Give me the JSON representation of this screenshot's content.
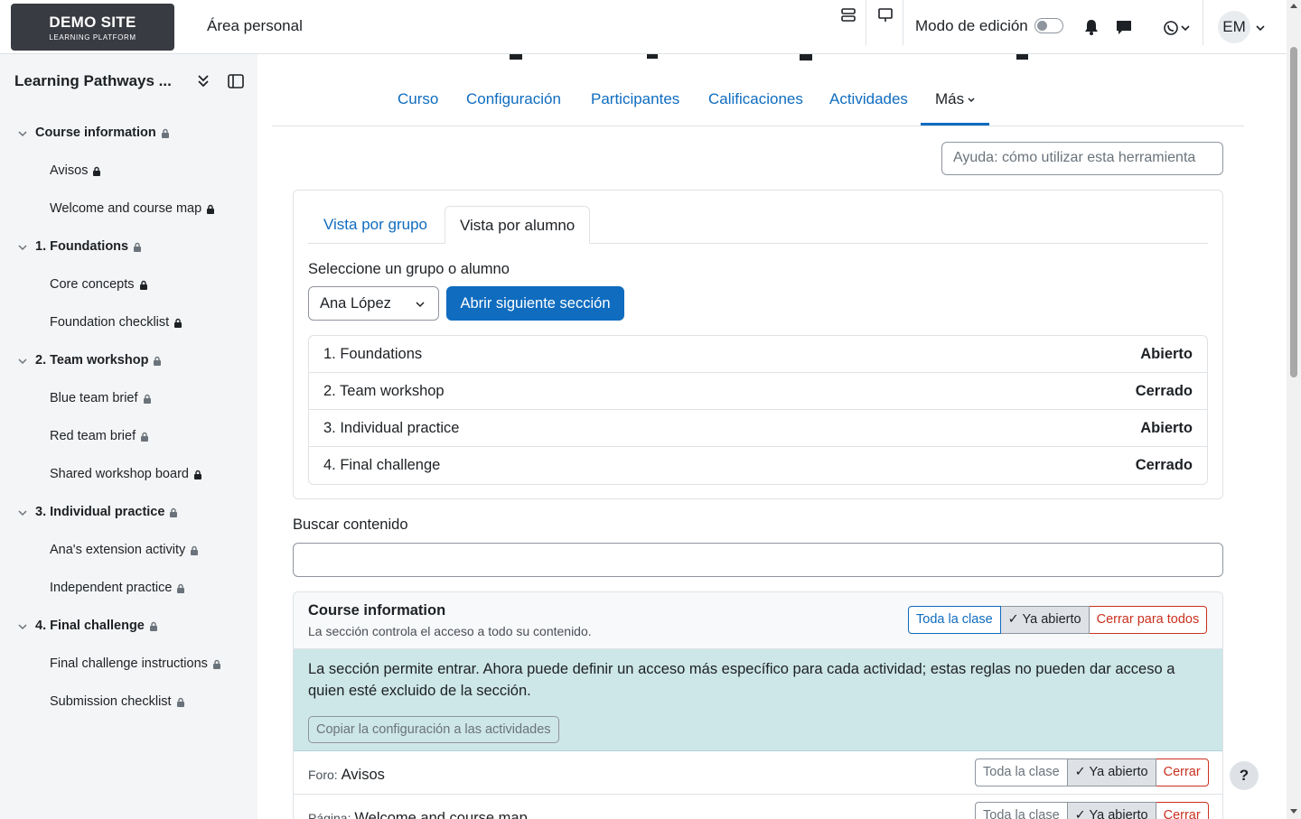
{
  "navbar": {
    "brand_title": "DEMO SITE",
    "brand_subtitle": "LEARNING PLATFORM",
    "home_link": "Área personal",
    "edit_mode_label": "Modo de edición",
    "avatar_initials": "EM"
  },
  "sidebar": {
    "course_title": "Learning Pathways ...",
    "sections": [
      {
        "label": "Course information",
        "items": [
          "Avisos",
          "Welcome and course map"
        ]
      },
      {
        "label": "1. Foundations",
        "items": [
          "Core concepts",
          "Foundation checklist"
        ]
      },
      {
        "label": "2. Team workshop",
        "items": [
          "Blue team brief",
          "Red team brief",
          "Shared workshop board"
        ]
      },
      {
        "label": "3. Individual practice",
        "items": [
          "Ana's extension activity",
          "Independent practice"
        ]
      },
      {
        "label": "4. Final challenge",
        "items": [
          "Final challenge instructions",
          "Submission checklist"
        ]
      }
    ]
  },
  "main": {
    "tabs": [
      "Curso",
      "Configuración",
      "Participantes",
      "Calificaciones",
      "Actividades",
      "Más"
    ],
    "help_button": "Ayuda: cómo utilizar esta herramienta",
    "subtabs": [
      "Vista por grupo",
      "Vista por alumno"
    ],
    "select_label": "Seleccione un grupo o alumno",
    "select_value": "Ana López",
    "open_next_button": "Abrir siguiente sección",
    "sections_status": [
      {
        "name": "1. Foundations",
        "status": "Abierto"
      },
      {
        "name": "2. Team workshop",
        "status": "Cerrado"
      },
      {
        "name": "3. Individual practice",
        "status": "Abierto"
      },
      {
        "name": "4. Final challenge",
        "status": "Cerrado"
      }
    ],
    "search_label": "Buscar contenido",
    "block": {
      "title": "Course information",
      "subtitle": "La sección controla el acceso a todo su contenido.",
      "btn_all_class": "Toda la clase",
      "btn_already_open": "✓ Ya abierto",
      "btn_close_all": "Cerrar para todos",
      "alert_text": "La sección permite entrar. Ahora puede definir un acceso más específico para cada actividad; estas reglas no pueden dar acceso a quien esté excluido de la sección.",
      "copy_button": "Copiar la configuración a las actividades",
      "activities": [
        {
          "type": "Foro:",
          "name": "Avisos",
          "btn_all": "Toda la clase",
          "btn_open": "✓ Ya abierto",
          "btn_close": "Cerrar"
        },
        {
          "type": "Página:",
          "name": "Welcome and course map",
          "btn_all": "Toda la clase",
          "btn_open": "✓ Ya abierto",
          "btn_close": "Cerrar"
        }
      ]
    }
  },
  "help_fab": "?"
}
